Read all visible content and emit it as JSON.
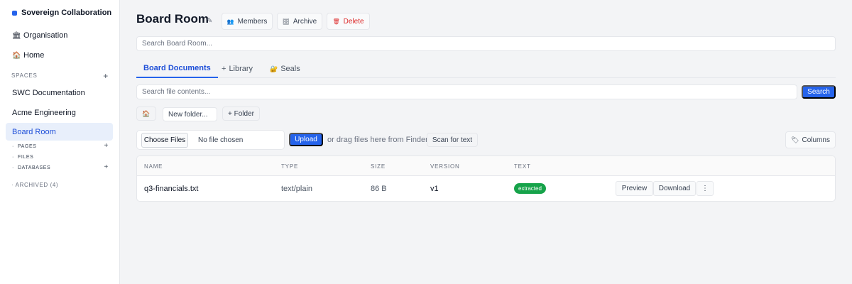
{
  "sidebar": {
    "brand": "Sovereign Collaboration",
    "brand_color": "#2563eb",
    "nav": [
      {
        "label": "Organisation",
        "icon": "building-icon"
      },
      {
        "label": "Home",
        "icon": "home-icon"
      }
    ],
    "spaces_label": "SPACES",
    "spaces": [
      {
        "label": "SWC Documentation",
        "active": false
      },
      {
        "label": "Acme Engineering",
        "active": false
      },
      {
        "label": "Board Room",
        "active": true
      }
    ],
    "sub_items": [
      {
        "label": "PAGES",
        "has_add": true
      },
      {
        "label": "FILES",
        "has_add": false
      },
      {
        "label": "DATABASES",
        "has_add": true
      }
    ],
    "archived": "ARCHIVED (4)"
  },
  "header": {
    "title": "Board Room",
    "members": "Members",
    "archive": "Archive",
    "delete": "Delete"
  },
  "space_search": {
    "placeholder": "Search Board Room..."
  },
  "tabs": [
    {
      "label": "Board Documents",
      "prefix": "",
      "active": true
    },
    {
      "label": "Library",
      "prefix": "+",
      "active": false
    },
    {
      "label": "Seals",
      "prefix": "🔐",
      "active": false
    }
  ],
  "file_search": {
    "placeholder": "Search file contents...",
    "button": "Search"
  },
  "folder": {
    "placeholder": "New folder...",
    "add_button": "+ Folder"
  },
  "upload": {
    "choose": "Choose Files",
    "no_file": "No file chosen",
    "upload_button": "Upload",
    "drag_hint": "or drag files here from Finder",
    "scan_button": "Scan for text",
    "columns_button": "Columns"
  },
  "table": {
    "headers": [
      "NAME",
      "TYPE",
      "SIZE",
      "VERSION",
      "TEXT"
    ],
    "rows": [
      {
        "name": "q3-financials.txt",
        "type": "text/plain",
        "size": "86 B",
        "version": "v1",
        "text_status": "extracted",
        "actions": {
          "preview": "Preview",
          "download": "Download",
          "more": "⋮"
        }
      }
    ]
  },
  "colors": {
    "accent": "#2563eb",
    "danger": "#dc2626",
    "success": "#16a34a"
  }
}
